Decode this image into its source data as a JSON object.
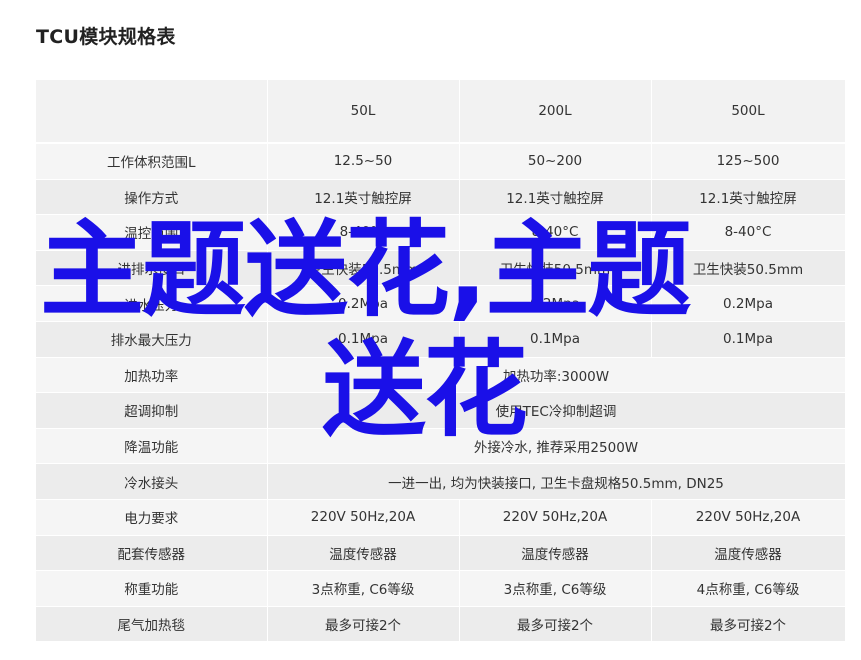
{
  "title": "TCU模块规格表",
  "table": {
    "headers": [
      "",
      "50L",
      "200L",
      "500L"
    ],
    "rows": [
      {
        "label": "工作体积范围L",
        "cells": [
          "12.5~50",
          "50~200",
          "125~500"
        ]
      },
      {
        "label": "操作方式",
        "cells": [
          "12.1英寸触控屏",
          "12.1英寸触控屏",
          "12.1英寸触控屏"
        ]
      },
      {
        "label": "温控范围",
        "cells": [
          "8-40°C",
          "8-40°C",
          "8-40°C"
        ]
      },
      {
        "label": "进排水接口",
        "cells": [
          "卫生快装50.5mm",
          "卫生快装50.5mm",
          "卫生快装50.5mm"
        ]
      },
      {
        "label": "进水压力",
        "cells": [
          "0.2Mpa",
          "0.2Mpa",
          "0.2Mpa"
        ]
      },
      {
        "label": "排水最大压力",
        "cells": [
          "0.1Mpa",
          "0.1Mpa",
          "0.1Mpa"
        ]
      },
      {
        "label": "加热功率",
        "merged": "加热功率:3000W"
      },
      {
        "label": "超调抑制",
        "merged": "使用TEC冷抑制超调"
      },
      {
        "label": "降温功能",
        "merged": "外接冷水, 推荐采用2500W"
      },
      {
        "label": "冷水接头",
        "merged": "一进一出, 均为快装接口, 卫生卡盘规格50.5mm, DN25"
      },
      {
        "label": "电力要求",
        "cells": [
          "220V 50Hz,20A",
          "220V 50Hz,20A",
          "220V 50Hz,20A"
        ]
      },
      {
        "label": "配套传感器",
        "cells": [
          "温度传感器",
          "温度传感器",
          "温度传感器"
        ]
      },
      {
        "label": "称重功能",
        "cells": [
          "3点称重, C6等级",
          "3点称重, C6等级",
          "4点称重, C6等级"
        ]
      },
      {
        "label": "尾气加热毯",
        "cells": [
          "最多可接2个",
          "最多可接2个",
          "最多可接2个"
        ]
      }
    ]
  },
  "watermark": {
    "line1": "主题送花,主题",
    "line2": "送花",
    "color": "#1a10e8"
  }
}
